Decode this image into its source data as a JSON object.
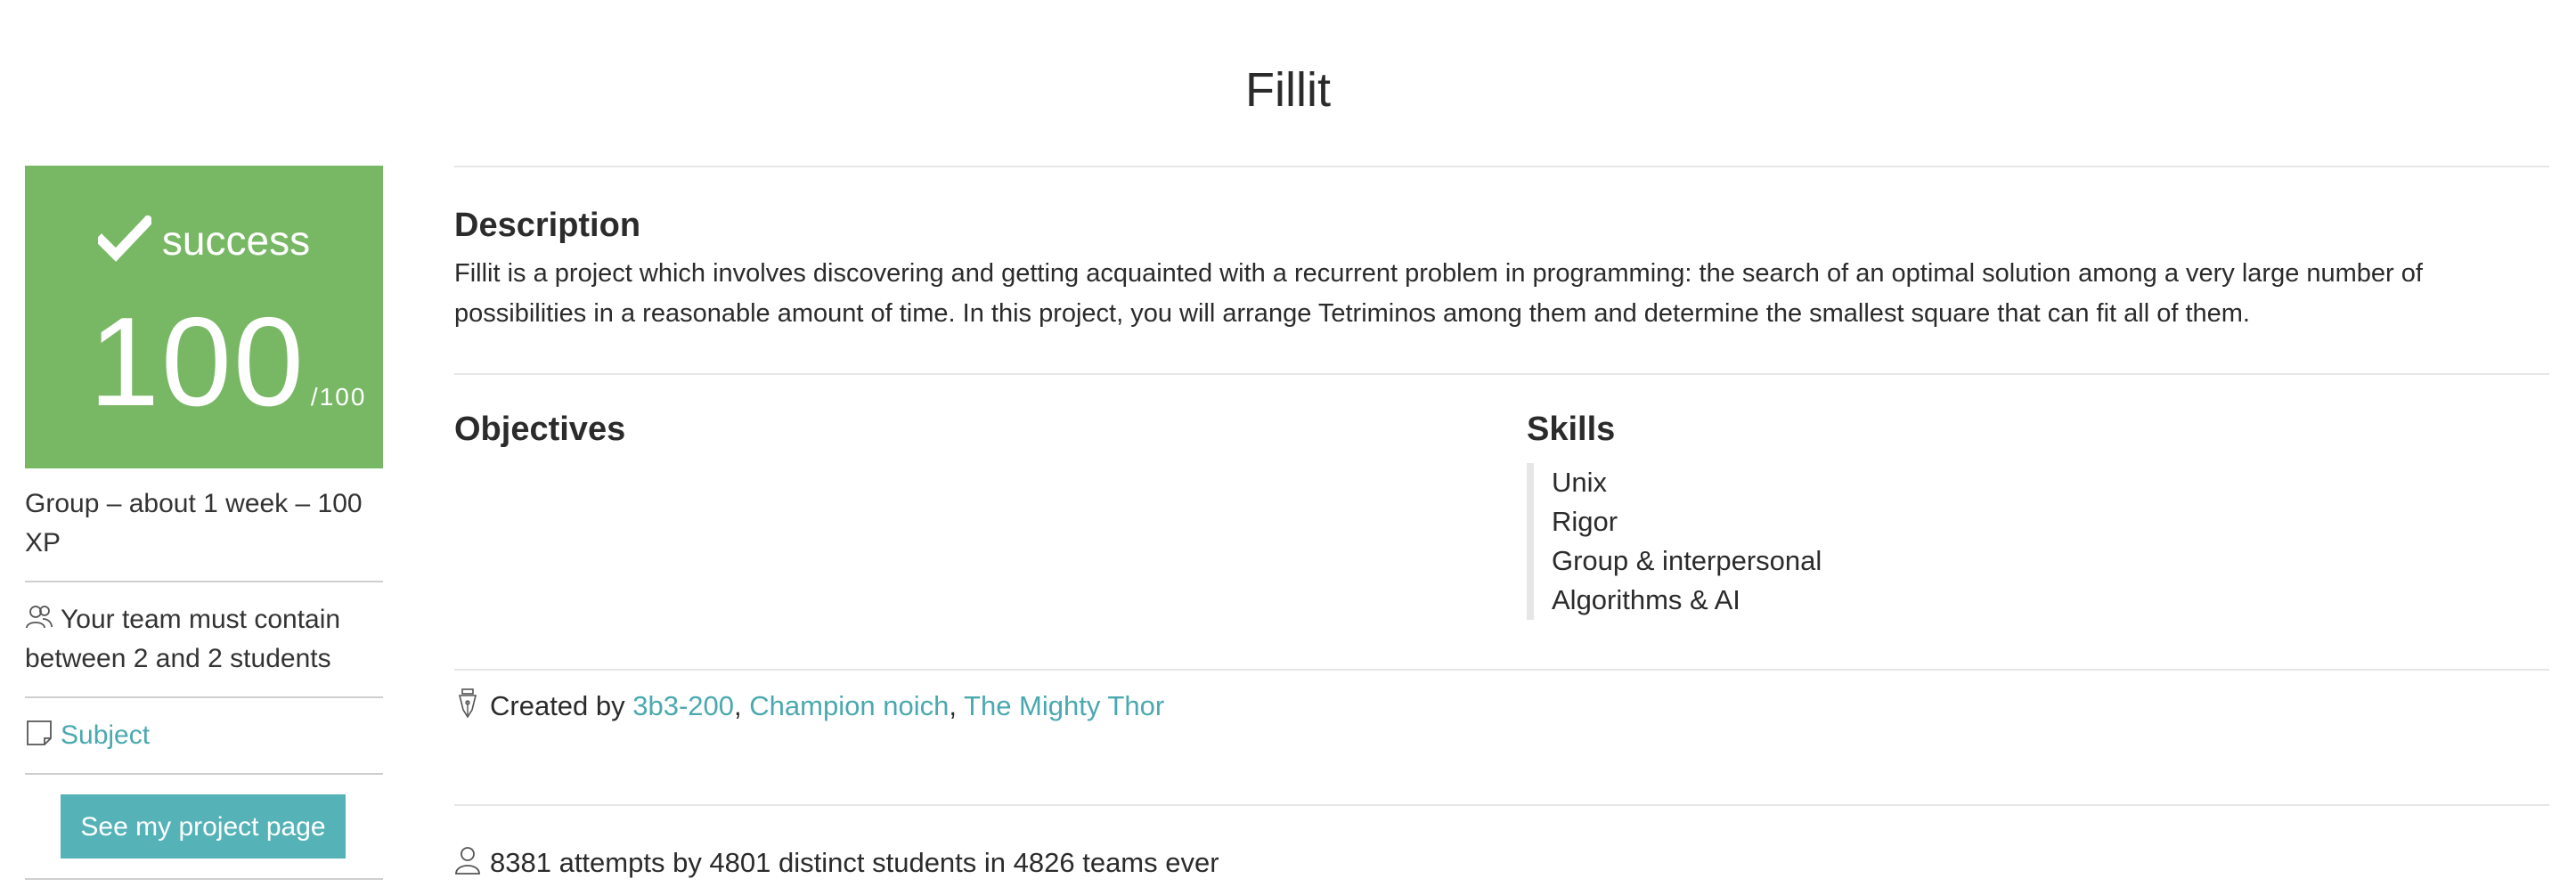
{
  "page": {
    "title": "Fillit"
  },
  "sidebar": {
    "status_label": "success",
    "score": "100",
    "score_max": "/100",
    "meta": "Group – about 1 week – 100 XP",
    "team_info": "Your team must contain between 2 and 2 students",
    "subject_label": "Subject",
    "project_button_label": "See my project page",
    "success_color": "#78b865",
    "accent_color": "#55b3b8"
  },
  "description": {
    "heading": "Description",
    "text": "Fillit is a project which involves discovering and getting acquainted with a recurrent problem in programming: the search of an optimal solution among a very large number of possibilities in a reasonable amount of time. In this project, you will arrange Tetriminos among them and determine the smallest square that can fit all of them."
  },
  "objectives": {
    "heading": "Objectives"
  },
  "skills": {
    "heading": "Skills",
    "items": [
      "Unix",
      "Rigor",
      "Group & interpersonal",
      "Algorithms & AI"
    ]
  },
  "credits": {
    "prefix": "Created by",
    "authors": [
      "3b3-200",
      "Champion noich",
      "The Mighty Thor"
    ],
    "separator": ","
  },
  "stats": {
    "text": "8381 attempts by 4801 distinct students in 4826 teams ever"
  },
  "icons": {
    "status": "check-icon",
    "team": "users-icon",
    "subject": "document-icon",
    "credits": "pen-nib-icon",
    "stats": "user-icon"
  }
}
